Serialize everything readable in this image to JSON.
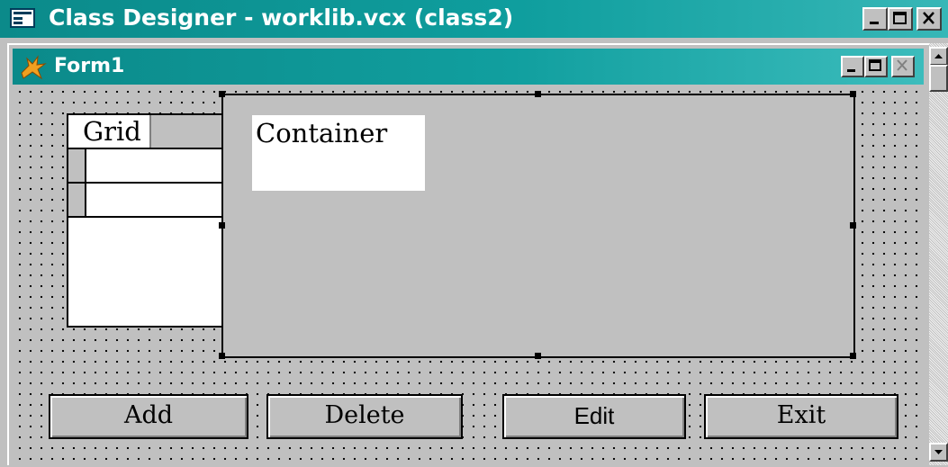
{
  "outer_window": {
    "title": "Class Designer - worklib.vcx (class2)",
    "app_icon": "window-icon",
    "controls": [
      "minimize-icon",
      "maximize-icon",
      "close-icon"
    ]
  },
  "child_window": {
    "title": "Form1",
    "app_icon": "fox-icon",
    "controls": [
      "minimize-icon",
      "maximize-icon",
      "close-icon"
    ]
  },
  "grid": {
    "header": "Grid"
  },
  "container": {
    "label": "Container"
  },
  "buttons": {
    "add": "Add",
    "delete": "Delete",
    "edit": "Edit",
    "exit": "Exit"
  },
  "colors": {
    "title_bar": "#0b8a8a",
    "form_background": "#c0c0c0"
  }
}
